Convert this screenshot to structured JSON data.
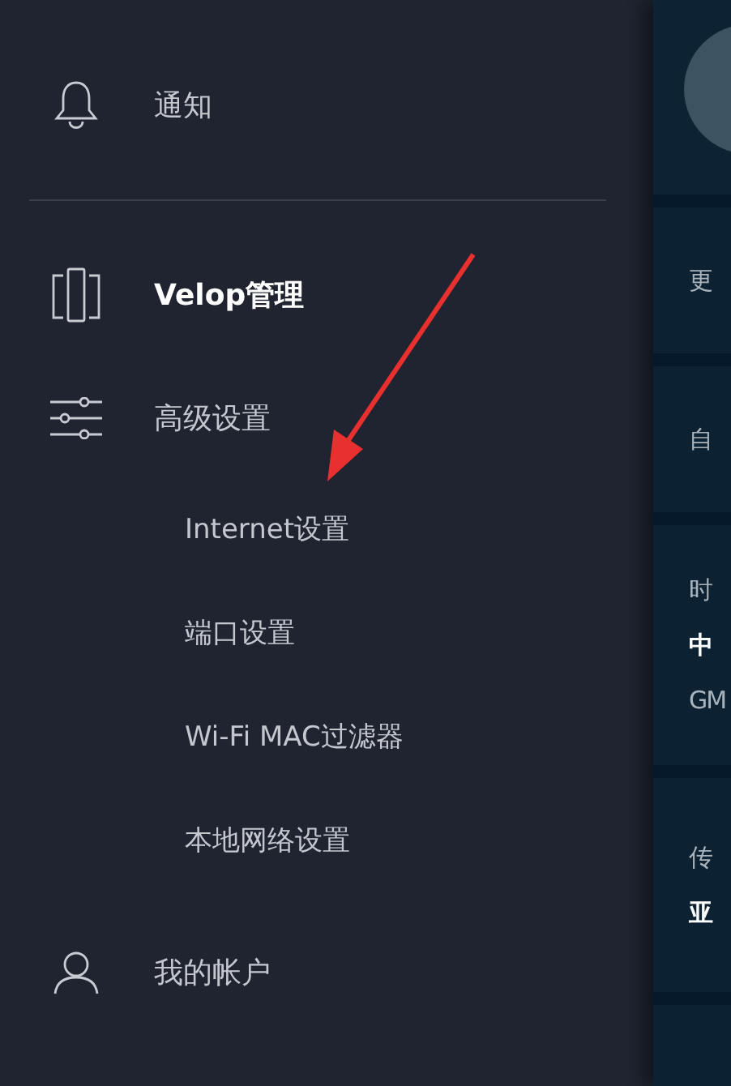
{
  "sidebar": {
    "items": [
      {
        "label": "通知",
        "selected": false
      },
      {
        "label": "Velop管理",
        "selected": true
      },
      {
        "label": "高级设置",
        "selected": false,
        "children": [
          {
            "label": "Internet设置",
            "selected": false
          },
          {
            "label": "端口设置",
            "selected": false
          },
          {
            "label": "Wi-Fi MAC过滤器",
            "selected": false
          },
          {
            "label": "本地网络设置",
            "selected": false
          }
        ]
      },
      {
        "label": "我的帐户",
        "selected": false
      }
    ]
  },
  "detail_panel": {
    "rows": [
      {
        "lines": [
          {
            "kind": "label",
            "text": "更"
          }
        ]
      },
      {
        "lines": [
          {
            "kind": "label",
            "text": "自"
          }
        ]
      },
      {
        "lines": [
          {
            "kind": "label",
            "text": "时"
          },
          {
            "kind": "value",
            "text": "中"
          },
          {
            "kind": "label",
            "text": "GM"
          }
        ]
      },
      {
        "lines": [
          {
            "kind": "label",
            "text": "传"
          },
          {
            "kind": "value",
            "text": "亚"
          }
        ]
      }
    ]
  }
}
